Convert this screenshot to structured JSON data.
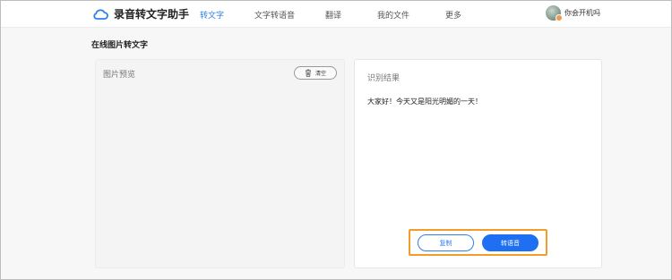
{
  "header": {
    "app_name": "录音转文字助手",
    "logo_icon": "cloud-icon",
    "nav": [
      {
        "label": "转文字",
        "active": true
      },
      {
        "label": "文字转语音",
        "active": false
      },
      {
        "label": "翻译",
        "active": false
      },
      {
        "label": "我的文件",
        "active": false
      },
      {
        "label": "更多",
        "active": false
      }
    ],
    "user": {
      "name": "你会开机吗",
      "avatar": "user-avatar"
    }
  },
  "page": {
    "title": "在线图片转文字"
  },
  "preview_panel": {
    "title": "图片预览",
    "clear_label": "清空",
    "clear_icon": "trash-icon"
  },
  "result_panel": {
    "title": "识别结果",
    "text": "大家好！今天又是阳光明媚的一天！",
    "copy_label": "复制",
    "to_voice_label": "转语音"
  },
  "colors": {
    "accent": "#2f80ed",
    "primary_button": "#1f6ff2",
    "highlight_box": "#f39b2b"
  }
}
